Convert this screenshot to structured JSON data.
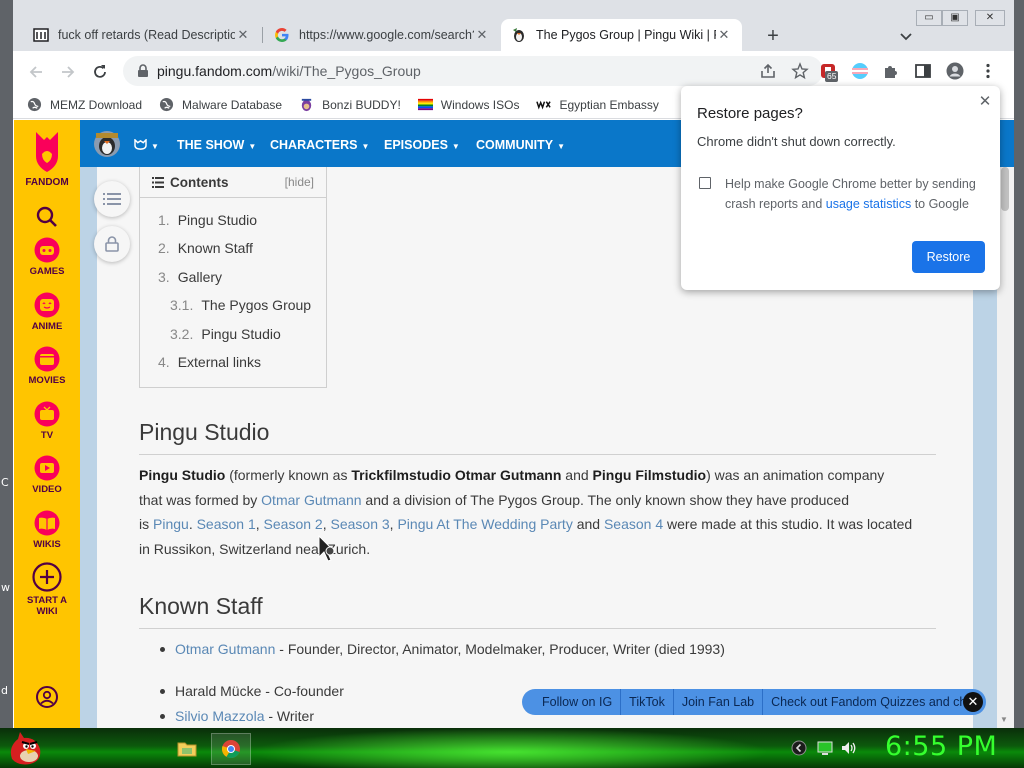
{
  "desktop": {
    "fragments": [
      "C",
      "w",
      "d"
    ]
  },
  "browser": {
    "tabs": [
      {
        "title": "fuck off retards (Read Description",
        "icon": "wiki-page-icon",
        "active": false
      },
      {
        "title": "https://www.google.com/search?",
        "icon": "google-icon",
        "active": false
      },
      {
        "title": "The Pygos Group | Pingu Wiki | Fa",
        "icon": "pingu-favicon",
        "active": true
      }
    ],
    "window_buttons": [
      "▭",
      "▣",
      "✕"
    ],
    "url_host": "pingu.fandom.com",
    "url_path": "/wiki/The_Pygos_Group",
    "extension_badge": "65",
    "bookmarks": [
      {
        "label": "MEMZ Download",
        "icon": "globe-icon"
      },
      {
        "label": "Malware Database",
        "icon": "globe-icon"
      },
      {
        "label": "Bonzi BUDDY!",
        "icon": "bonzi-icon"
      },
      {
        "label": "Windows ISOs",
        "icon": "rainbow-flag-icon"
      },
      {
        "label": "Egyptian Embassy",
        "icon": "wix-icon"
      }
    ]
  },
  "fandom": {
    "brand": "FANDOM",
    "rail": [
      {
        "label": "GAMES",
        "icon": "games-icon"
      },
      {
        "label": "ANIME",
        "icon": "anime-icon"
      },
      {
        "label": "MOVIES",
        "icon": "movies-icon"
      },
      {
        "label": "TV",
        "icon": "tv-icon"
      },
      {
        "label": "VIDEO",
        "icon": "video-icon"
      },
      {
        "label": "WIKIS",
        "icon": "wikis-icon"
      },
      {
        "label": "START A WIKI",
        "icon": "plus-circle-icon"
      }
    ],
    "nav": [
      {
        "label": "THE SHOW"
      },
      {
        "label": "CHARACTERS"
      },
      {
        "label": "EPISODES"
      },
      {
        "label": "COMMUNITY"
      }
    ],
    "nav_caret": "▼",
    "colors": {
      "rail": "#ffc500",
      "header": "#0a77c9",
      "link": "#5a88b5"
    }
  },
  "toc": {
    "title": "Contents",
    "hide": "[hide]",
    "items": [
      {
        "num": "1.",
        "label": "Pingu Studio"
      },
      {
        "num": "2.",
        "label": "Known Staff"
      },
      {
        "num": "3.",
        "label": "Gallery"
      },
      {
        "num": "3.1.",
        "label": "The Pygos Group"
      },
      {
        "num": "3.2.",
        "label": "Pingu Studio"
      },
      {
        "num": "4.",
        "label": "External links"
      }
    ]
  },
  "article": {
    "h_studio": "Pingu Studio",
    "p1": {
      "b1": "Pingu Studio",
      "t1": " (formerly known as ",
      "b2": "Trickfilmstudio Otmar Gutmann",
      "t2": " and ",
      "b3": "Pingu Filmstudio",
      "t3": ") was an animation company",
      "t4": "that was formed by ",
      "l1": "Otmar Gutmann",
      "t5": " and a division of The Pygos Group. The only known show they have produced",
      "t6": "is ",
      "l2": "Pingu",
      "t7": ". ",
      "l3": "Season 1",
      "t8": ", ",
      "l4": "Season 2",
      "t9": ", ",
      "l5": "Season 3",
      "t10": ", ",
      "l6": "Pingu At The Wedding Party",
      "t11": " and ",
      "l7": "Season 4",
      "t12": " were made at this studio. It was located",
      "t13": "in Russikon, Switzerland near Zurich."
    },
    "h_staff": "Known Staff",
    "staff": [
      {
        "name": "Otmar Gutmann",
        "linked": true,
        "role": " - Founder, Director, Animator, Modelmaker, Producer, Writer (died 1993)"
      },
      {
        "name": "Harald Mücke",
        "linked": false,
        "role": " - Co-founder"
      },
      {
        "name": "Silvio Mazzola",
        "linked": true,
        "role": " - Writer"
      }
    ]
  },
  "promo": {
    "items": [
      "Follow on IG",
      "TikTok",
      "Join Fan Lab",
      "Check out Fandom Quizzes and cha"
    ],
    "close": "✕"
  },
  "restore_dialog": {
    "title": "Restore pages?",
    "message": "Chrome didn't shut down correctly.",
    "help_pre": "Help make Google Chrome better by sending crash reports and ",
    "help_link": "usage statistics",
    "help_post": " to Google",
    "button": "Restore",
    "close": "✕"
  },
  "taskbar": {
    "clock": "6:55 PM"
  }
}
